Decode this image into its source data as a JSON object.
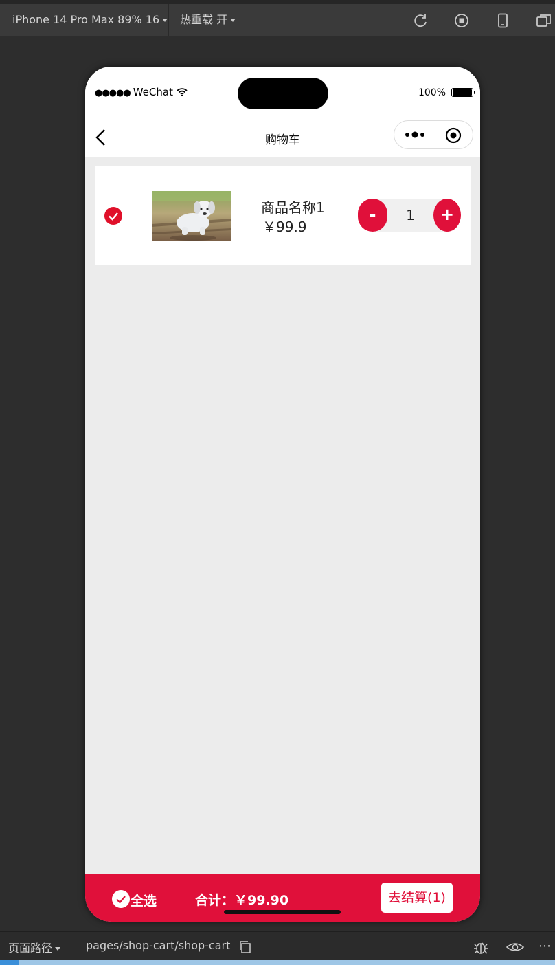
{
  "toolbar": {
    "device": "iPhone 14 Pro Max 89% 16",
    "hot_reload": "热重载 开"
  },
  "status_bar": {
    "carrier": "WeChat",
    "battery": "100%"
  },
  "nav": {
    "title": "购物车"
  },
  "cart": {
    "items": [
      {
        "name": "商品名称1",
        "price": "￥99.9",
        "quantity": "1",
        "checked": true,
        "image": "puppy-photo"
      }
    ]
  },
  "stepper": {
    "minus": "-",
    "plus": "+"
  },
  "bottom_bar": {
    "select_all": "全选",
    "total": "合计：￥99.90",
    "checkout": "去结算(1)"
  },
  "footer": {
    "path_label": "页面路径",
    "path_value": "pages/shop-cart/shop-cart"
  },
  "colors": {
    "accent": "#e0103a",
    "page_bg": "#ececec"
  }
}
